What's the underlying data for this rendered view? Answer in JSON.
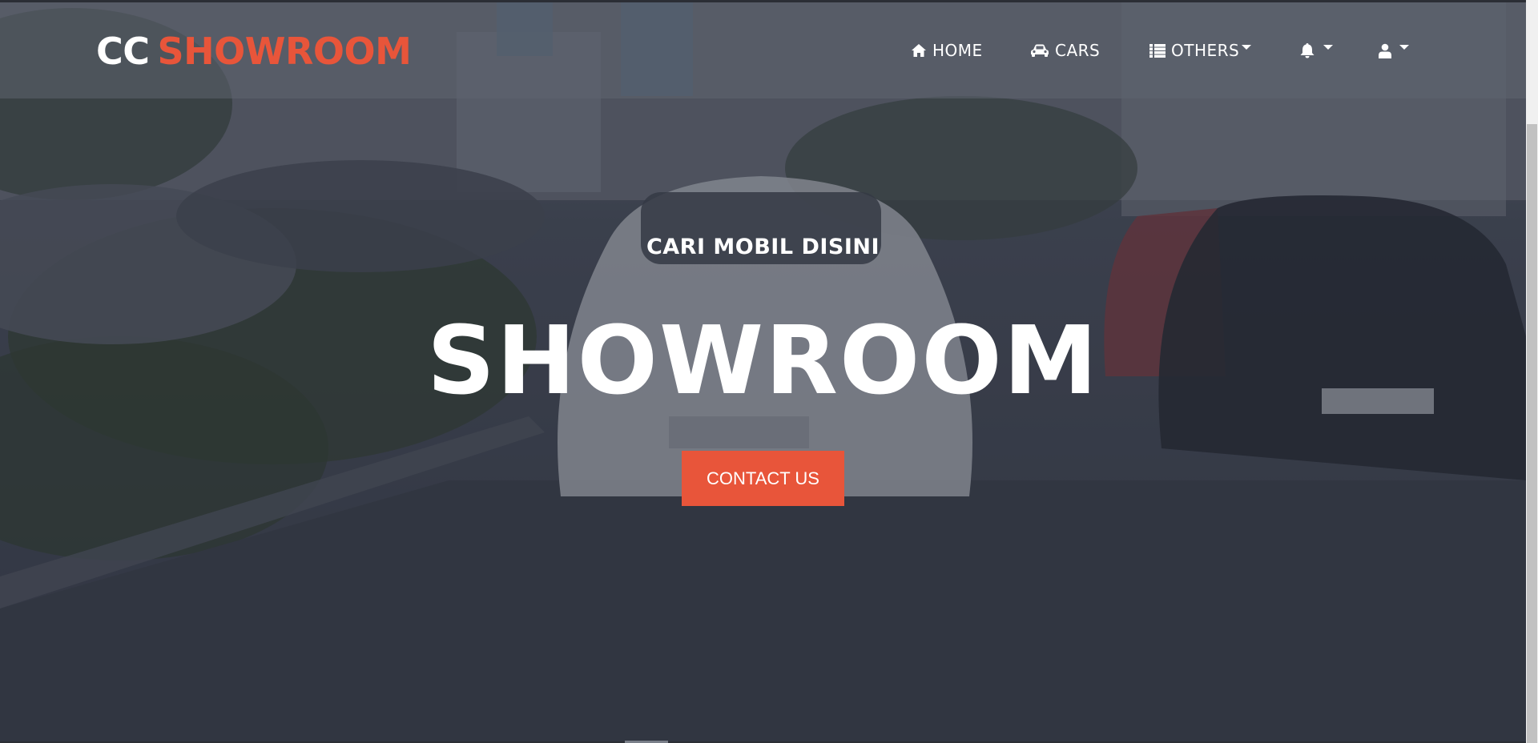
{
  "brand": {
    "part1": "CC",
    "part2": "SHOWROOM"
  },
  "nav": {
    "home": {
      "label": "HOME",
      "icon": "home-icon"
    },
    "cars": {
      "label": "CARS",
      "icon": "car-icon"
    },
    "others": {
      "label": "OTHERS",
      "icon": "list-icon",
      "dropdown": true
    },
    "notifications": {
      "icon": "bell-icon",
      "dropdown": true
    },
    "user": {
      "icon": "user-icon",
      "dropdown": true
    }
  },
  "hero": {
    "subtitle": "CARI MOBIL DISINI",
    "title": "SHOWROOM",
    "cta_label": "CONTACT US"
  },
  "colors": {
    "accent": "#e8553a",
    "text": "#ffffff",
    "navbar_bg": "rgba(95, 100, 112, 0.55)",
    "hero_overlay": "rgba(40, 45, 58, 0.45)"
  }
}
